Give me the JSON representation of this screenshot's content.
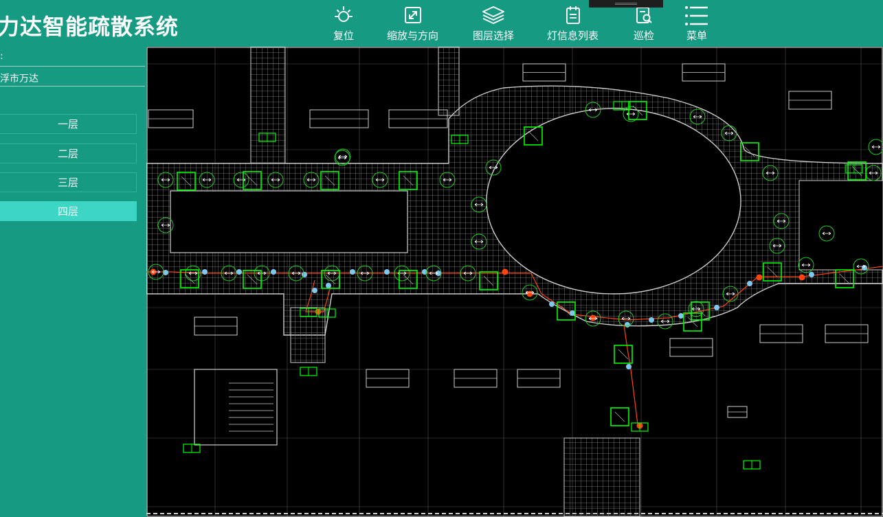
{
  "app": {
    "title": "力达智能疏散系统"
  },
  "toolbar": {
    "items": [
      {
        "label": "复位",
        "icon": "sun-icon"
      },
      {
        "label": "缩放与方向",
        "icon": "zoom-arrows-icon"
      },
      {
        "label": "图层选择",
        "icon": "layers-icon"
      },
      {
        "label": "灯信息列表",
        "icon": "clipboard-list-icon"
      },
      {
        "label": "巡检",
        "icon": "inspect-search-icon"
      },
      {
        "label": "菜单",
        "icon": "menu-icon"
      }
    ]
  },
  "sidebar": {
    "label1": ":",
    "location": "浮市万达",
    "floors": [
      {
        "label": "一层",
        "active": false
      },
      {
        "label": "二层",
        "active": false
      },
      {
        "label": "三层",
        "active": false
      },
      {
        "label": "四层",
        "active": true
      }
    ]
  },
  "map": {
    "colors": {
      "background": "#000000",
      "wall": "#d0d0d0",
      "grid": "#8a8a8a",
      "indicator": "#22cc22",
      "exit": "#00ff00",
      "route": "#ff4411",
      "node": "#7ec8f0"
    }
  },
  "colors": {
    "brand": "#179a82",
    "active_floor": "#3dd6c4"
  }
}
